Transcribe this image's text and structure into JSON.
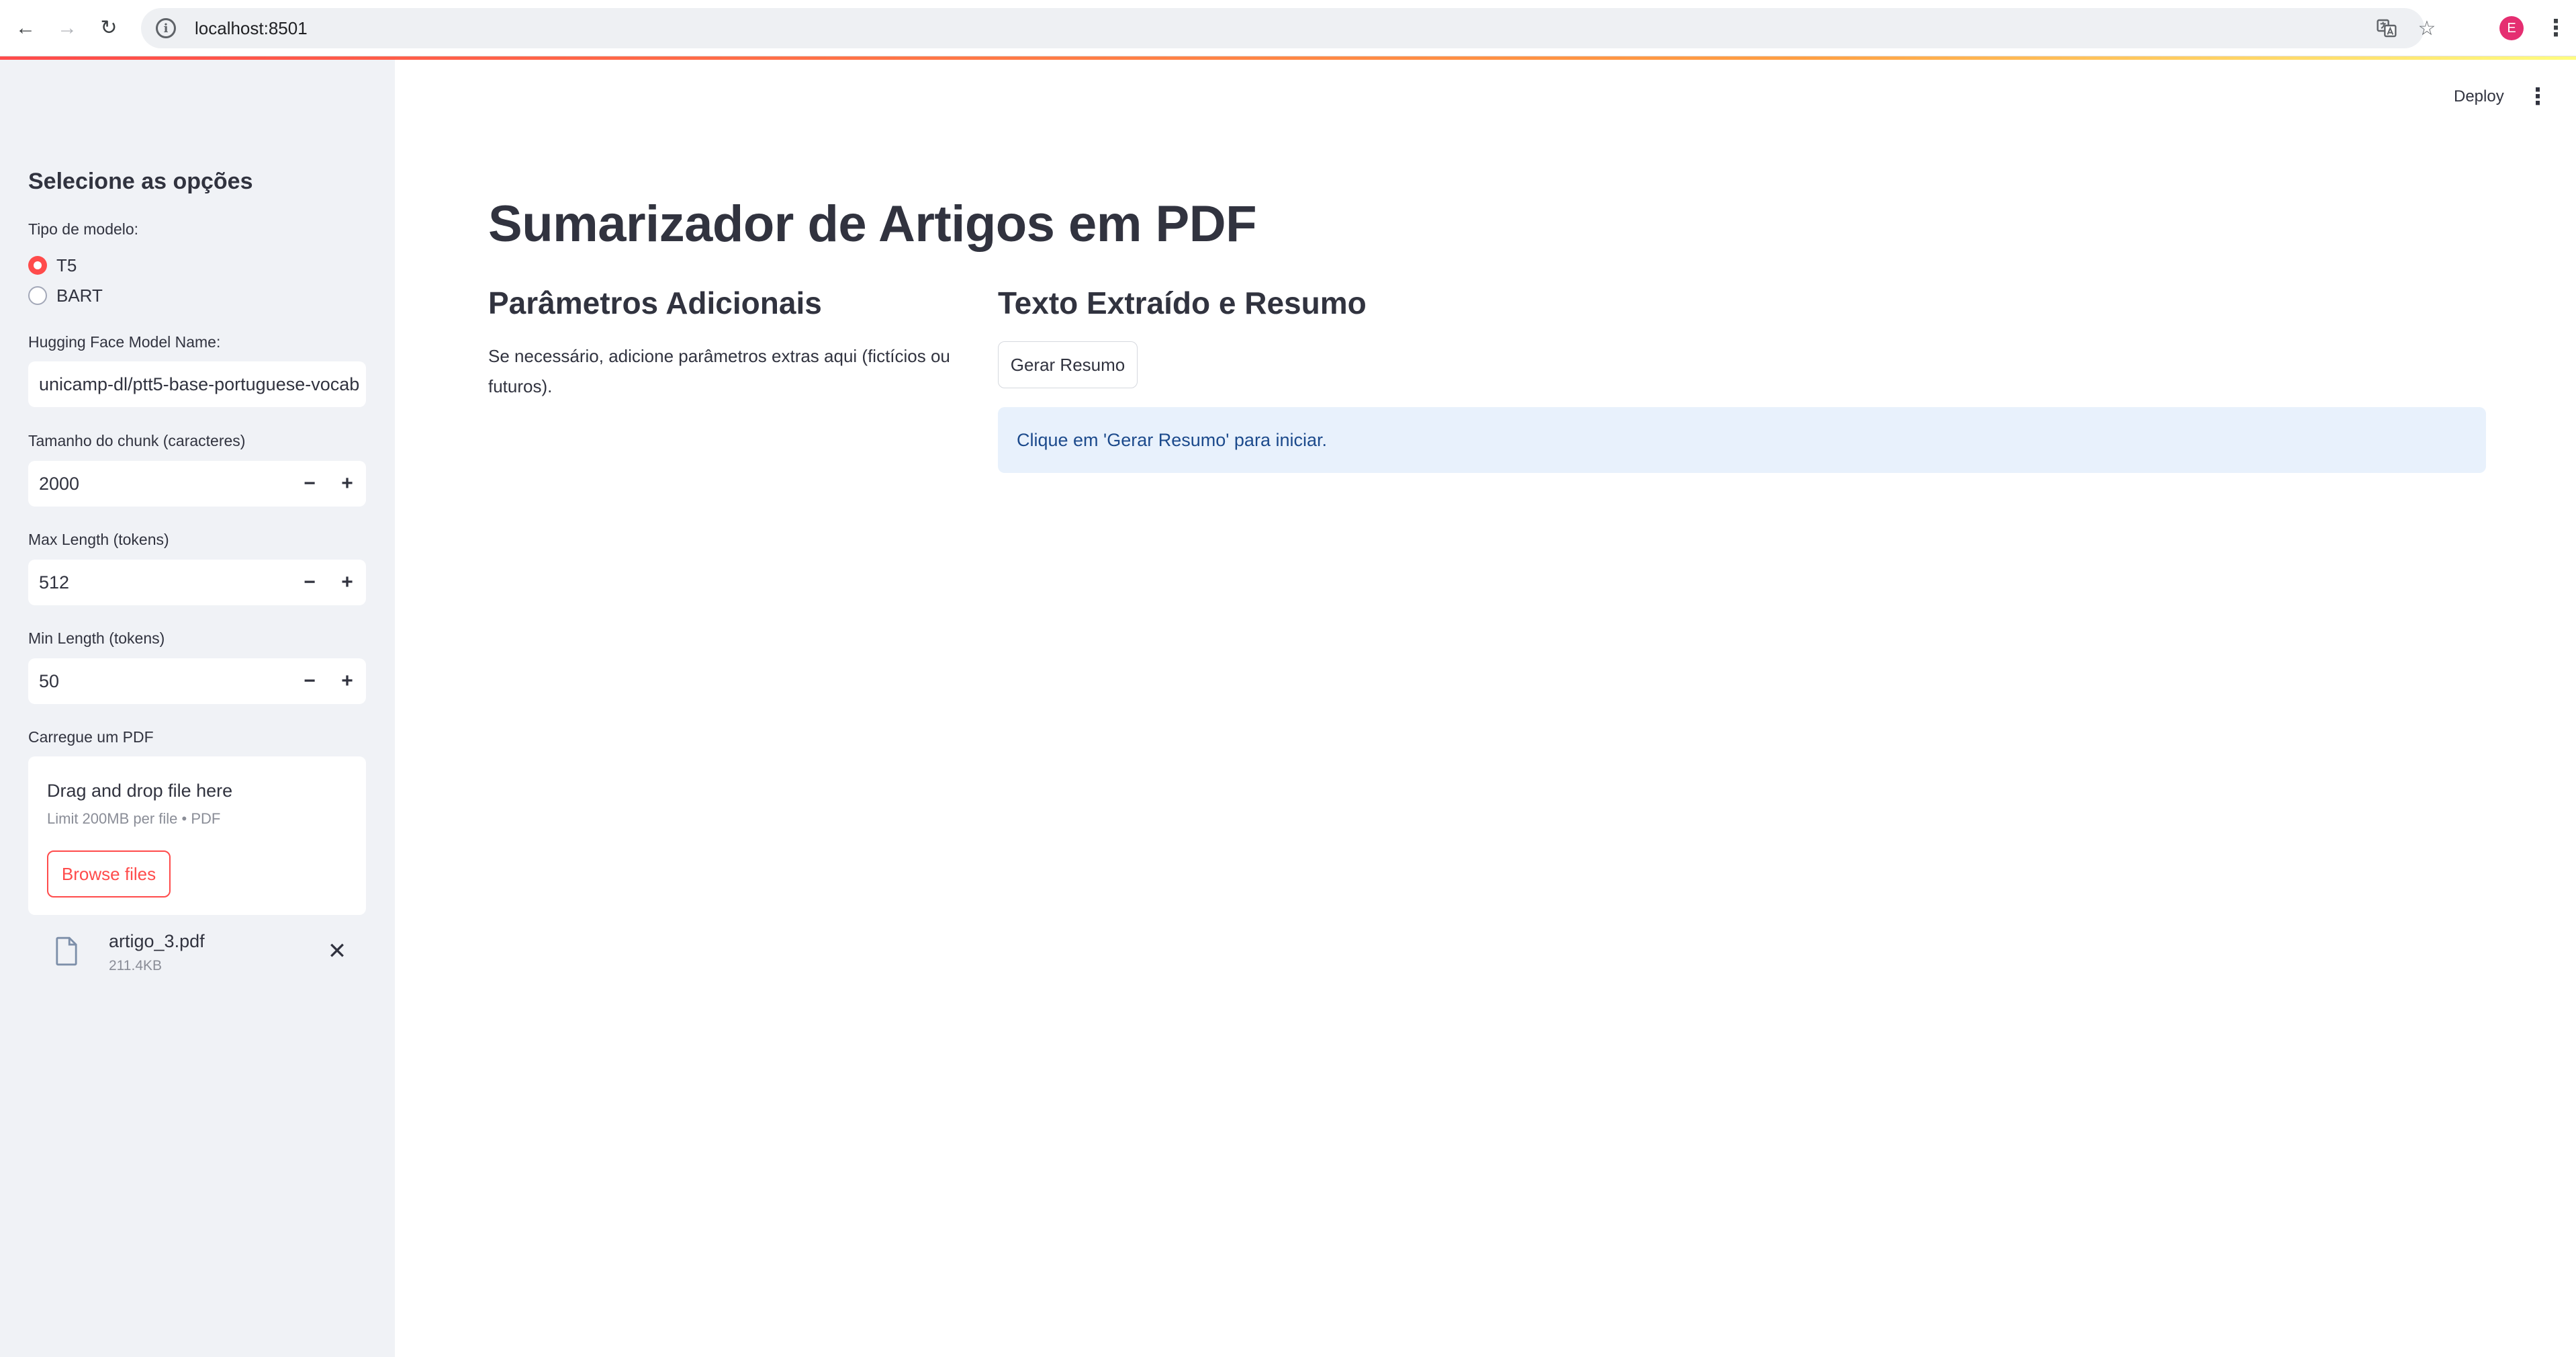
{
  "browser": {
    "url": "localhost:8501",
    "profile_initial": "E",
    "icons": [
      "back-arrow-icon",
      "forward-arrow-icon",
      "reload-icon",
      "site-info-icon",
      "translate-icon",
      "bookmark-star-icon",
      "chrome-menu-icon"
    ]
  },
  "sidebar": {
    "title": "Selecione as opções",
    "model_type": {
      "label": "Tipo de modelo:",
      "options": [
        "T5",
        "BART"
      ],
      "selected": "T5"
    },
    "hf_model": {
      "label": "Hugging Face Model Name:",
      "value": "unicamp-dl/ptt5-base-portuguese-vocab"
    },
    "chunk_size": {
      "label": "Tamanho do chunk (caracteres)",
      "value": "2000"
    },
    "max_length": {
      "label": "Max Length (tokens)",
      "value": "512"
    },
    "min_length": {
      "label": "Min Length (tokens)",
      "value": "50"
    },
    "stepper": {
      "minus": "−",
      "plus": "+"
    },
    "uploader": {
      "label": "Carregue um PDF",
      "drop_text": "Drag and drop file here",
      "limit_text": "Limit 200MB per file • PDF",
      "browse_label": "Browse files",
      "file": {
        "name": "artigo_3.pdf",
        "size": "211.4KB"
      }
    }
  },
  "header": {
    "deploy_label": "Deploy"
  },
  "main": {
    "title": "Sumarizador de Artigos em PDF",
    "params_heading": "Parâmetros Adicionais",
    "params_text": "Se necessário, adicione parâmetros extras aqui (fictícios ou futuros).",
    "result_heading": "Texto Extraído e Resumo",
    "generate_label": "Gerar Resumo",
    "info_message": "Clique em 'Gerar Resumo' para iniciar."
  },
  "colors": {
    "accent": "#ff4b4b",
    "sidebar_bg": "#f0f2f6",
    "info_bg": "#e8f1fc",
    "info_text": "#1c4a8c",
    "text": "#31333f"
  }
}
